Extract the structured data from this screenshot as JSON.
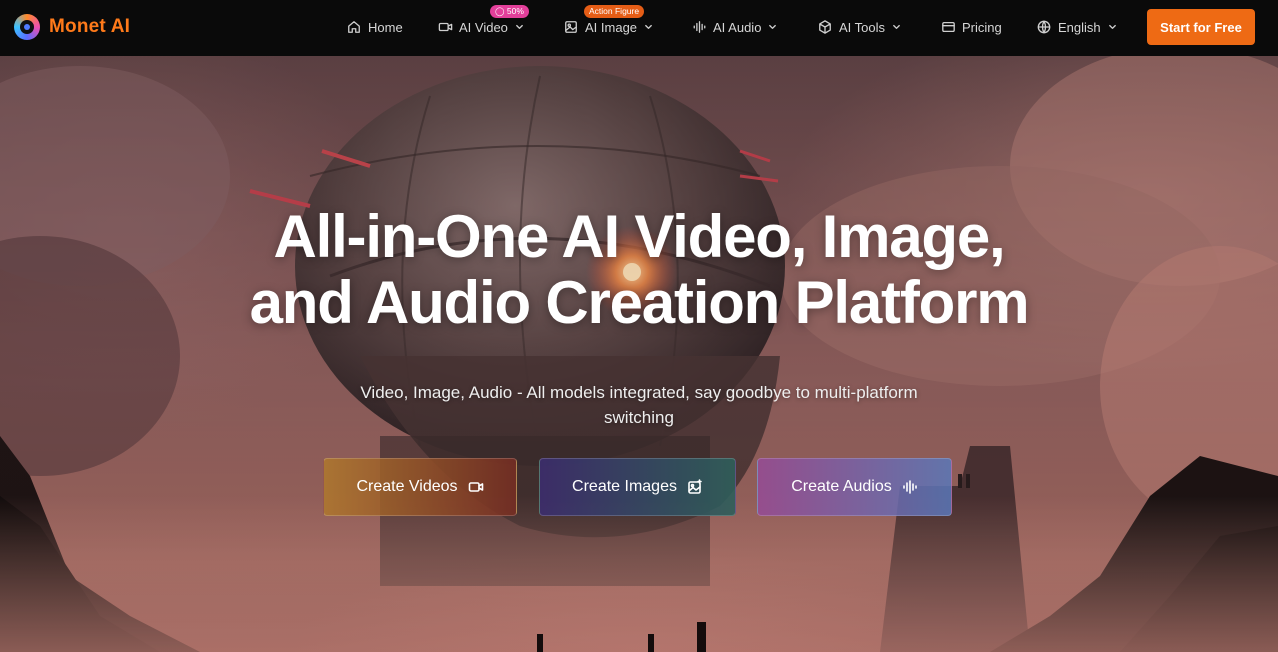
{
  "brand": {
    "name": "Monet AI"
  },
  "nav": {
    "items": [
      {
        "label": "Home",
        "icon": "home-icon"
      },
      {
        "label": "AI Video",
        "icon": "video-icon",
        "badge": "50%"
      },
      {
        "label": "AI Image",
        "icon": "image-icon",
        "badge": "Action Figure"
      },
      {
        "label": "AI Audio",
        "icon": "audio-wave-icon"
      },
      {
        "label": "AI Tools",
        "icon": "box-icon"
      },
      {
        "label": "Pricing",
        "icon": "card-icon"
      },
      {
        "label": "English",
        "icon": "globe-icon"
      }
    ],
    "cta_label": "Start for Free"
  },
  "hero": {
    "title_line1": "All-in-One AI Video, Image,",
    "title_line2": "and Audio Creation Platform",
    "subtitle_line1": "Video, Image, Audio - All models integrated, say goodbye to multi-platform",
    "subtitle_line2": "switching",
    "buttons": [
      {
        "label": "Create Videos",
        "icon": "video-icon"
      },
      {
        "label": "Create Images",
        "icon": "image-sparkle-icon"
      },
      {
        "label": "Create Audios",
        "icon": "audio-wave-icon"
      }
    ]
  },
  "colors": {
    "accent": "#ee6a14",
    "brand_text": "#ff7a1a",
    "badge_pink": "#e23f9a",
    "badge_orange": "#e55d16",
    "nav_bg": "#0a0a0a"
  }
}
